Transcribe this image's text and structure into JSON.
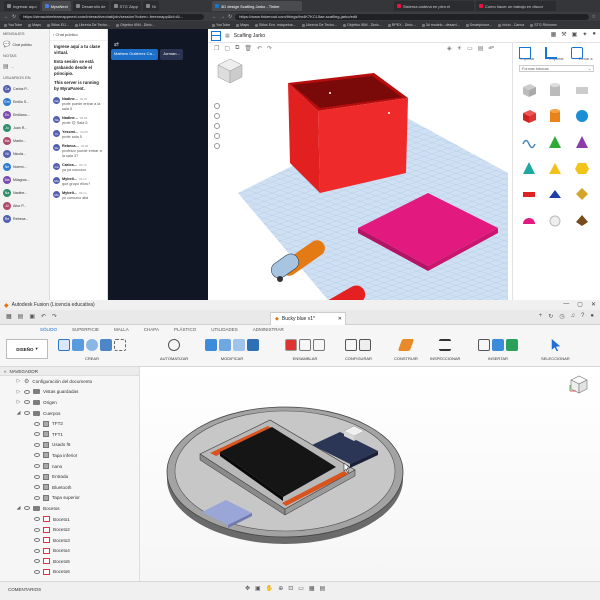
{
  "top": {
    "left_window": {
      "tabs": [
        "Ingresar aquí",
        "MyraNext",
        "Desarrollo de",
        "STG Zapp",
        "Ni"
      ],
      "url": "https://stmachinelearnappnext.com/interactivechat/join/session?token=-freeonapp&id=Ai...",
      "bookmarks": [
        "YouTube",
        "Maps",
        "Sitios ElJ...",
        "Librería De Techo...",
        "Objetivo IBM - Dinic...",
        "RPEX - Dinic...",
        "Librería...",
        "Librería M..."
      ]
    },
    "right_window": {
      "tabs": [
        "3D design Scafling Jarko - Tinker",
        "Sistema cadena en plen el",
        "Como hacer un trabajo en discor"
      ],
      "url": "https://www.tinkercad.com/things/fm4K7KCL5ae-scafling-jarko/edit",
      "bookmarks": [
        "YouTube",
        "Maps",
        "Sitios Ecn, máqueina...",
        "Librería De Techo...",
        "Objetivo IBM - Dinic...",
        "RPEX - Dinic...",
        "3d modelo - desarrl...",
        "Smartphone...",
        "Inicio - Canva",
        "STG Rhinomv"
      ]
    },
    "teams": {
      "sections": [
        "MENSAJES",
        "NOTAS",
        "USUARIOS EN"
      ],
      "users": [
        {
          "initials": "Ca",
          "name": "Carlos P..."
        },
        {
          "initials": "Em",
          "name": "Emilio S..."
        },
        {
          "initials": "Es",
          "name": "Emiliano..."
        },
        {
          "initials": "Ju",
          "name": "Juan R..."
        },
        {
          "initials": "Ma",
          "name": "Martín..."
        },
        {
          "initials": "Ni",
          "name": "Nicolá..."
        },
        {
          "initials": "Ne",
          "name": "Noemí..."
        },
        {
          "initials": "Ma",
          "name": "Milagros..."
        },
        {
          "initials": "Na",
          "name": "Nadine..."
        },
        {
          "initials": "Ai",
          "name": "Aitor P..."
        },
        {
          "initials": "Re",
          "name": "Rebeca..."
        }
      ],
      "chat_publico_label": "Chat público"
    },
    "chat": {
      "header": "Chat público",
      "intro": [
        "Ingrese aquí a tu clase virtual.",
        "Esta sesión se está grabando desde el principio.",
        "This server is running by MyraParent."
      ],
      "messages": [
        {
          "initials": "Na",
          "name": "Nadine...",
          "time": "09:05",
          "text": "profe puede entrar a la sala 5"
        },
        {
          "initials": "Na",
          "name": "Nadine...",
          "time": "09:08",
          "text": "profe 😊 Sala 5"
        },
        {
          "initials": "Yo",
          "name": "Yessmi...",
          "time": "09:08",
          "text": "profe sala 5"
        },
        {
          "initials": "Re",
          "name": "Rebeca...",
          "time": "09:08",
          "text": "profesor puede entrar a la sala 3?"
        },
        {
          "initials": "Ca",
          "name": "Carlos...",
          "time": "09:10",
          "text": "ya ya conozco"
        },
        {
          "initials": "Ma",
          "name": "Mybeli...",
          "time": "09:14",
          "text": "qué grupo ellos?"
        },
        {
          "initials": "Ma",
          "name": "Mybeli...",
          "time": "09:14",
          "text": "yo conozco allá"
        }
      ]
    },
    "meet": {
      "pills": [
        "Mathew Gutiérrez Ca...",
        "Jorman..."
      ]
    },
    "tinkercad": {
      "title": "Scafling Jarko",
      "panel_labels": [
        "Importar",
        "Exportar",
        "Enviar a"
      ],
      "shape_category": "Formas básicas"
    }
  },
  "fusion": {
    "app_title": "Autodesk Fusion (Licencia educativa)",
    "doc_tab": "Bucky blue v1*",
    "tabs": [
      "SÓLIDO",
      "SUPERFICIE",
      "MALLA",
      "CHAPA",
      "PLÁSTICO",
      "UTILIDADES",
      "ADMINISTRAR"
    ],
    "design_label": "DISEÑO",
    "ribbon_groups": [
      "CREAR",
      "AUTOMATIZAR",
      "MODIFICAR",
      "ENSAMBLAR",
      "CONFIGURAR",
      "CONSTRUIR",
      "INSPECCIONAR",
      "INSERTAR",
      "SELECCIONAR"
    ],
    "browser_title": "NAVEGADOR",
    "tree": [
      {
        "label": "Configuración del documento",
        "level": 1,
        "icon": "gear"
      },
      {
        "label": "Vistas guardadas",
        "level": 1,
        "icon": "folder"
      },
      {
        "label": "Origen",
        "level": 1,
        "icon": "folder"
      },
      {
        "label": "Cuerpos",
        "level": 1,
        "icon": "folder"
      },
      {
        "label": "TFT2",
        "level": 2,
        "icon": "body"
      },
      {
        "label": "TFT1",
        "level": 2,
        "icon": "body"
      },
      {
        "label": "Usado f6",
        "level": 2,
        "icon": "body"
      },
      {
        "label": "Tapa inferior",
        "level": 2,
        "icon": "body"
      },
      {
        "label": "nano",
        "level": 2,
        "icon": "body"
      },
      {
        "label": "Entrada",
        "level": 2,
        "icon": "body"
      },
      {
        "label": "Bluetooth",
        "level": 2,
        "icon": "body"
      },
      {
        "label": "Tapa superior",
        "level": 2,
        "icon": "body"
      },
      {
        "label": "Bocetos",
        "level": 1,
        "icon": "folder"
      },
      {
        "label": "Boceto1",
        "level": 2,
        "icon": "sketch"
      },
      {
        "label": "Boceto2",
        "level": 2,
        "icon": "sketch"
      },
      {
        "label": "Boceto3",
        "level": 2,
        "icon": "sketch"
      },
      {
        "label": "Boceto4",
        "level": 2,
        "icon": "sketch"
      },
      {
        "label": "Boceto5",
        "level": 2,
        "icon": "sketch"
      },
      {
        "label": "Boceto6",
        "level": 2,
        "icon": "sketch"
      }
    ],
    "comments_label": "COMENTARIOS"
  }
}
